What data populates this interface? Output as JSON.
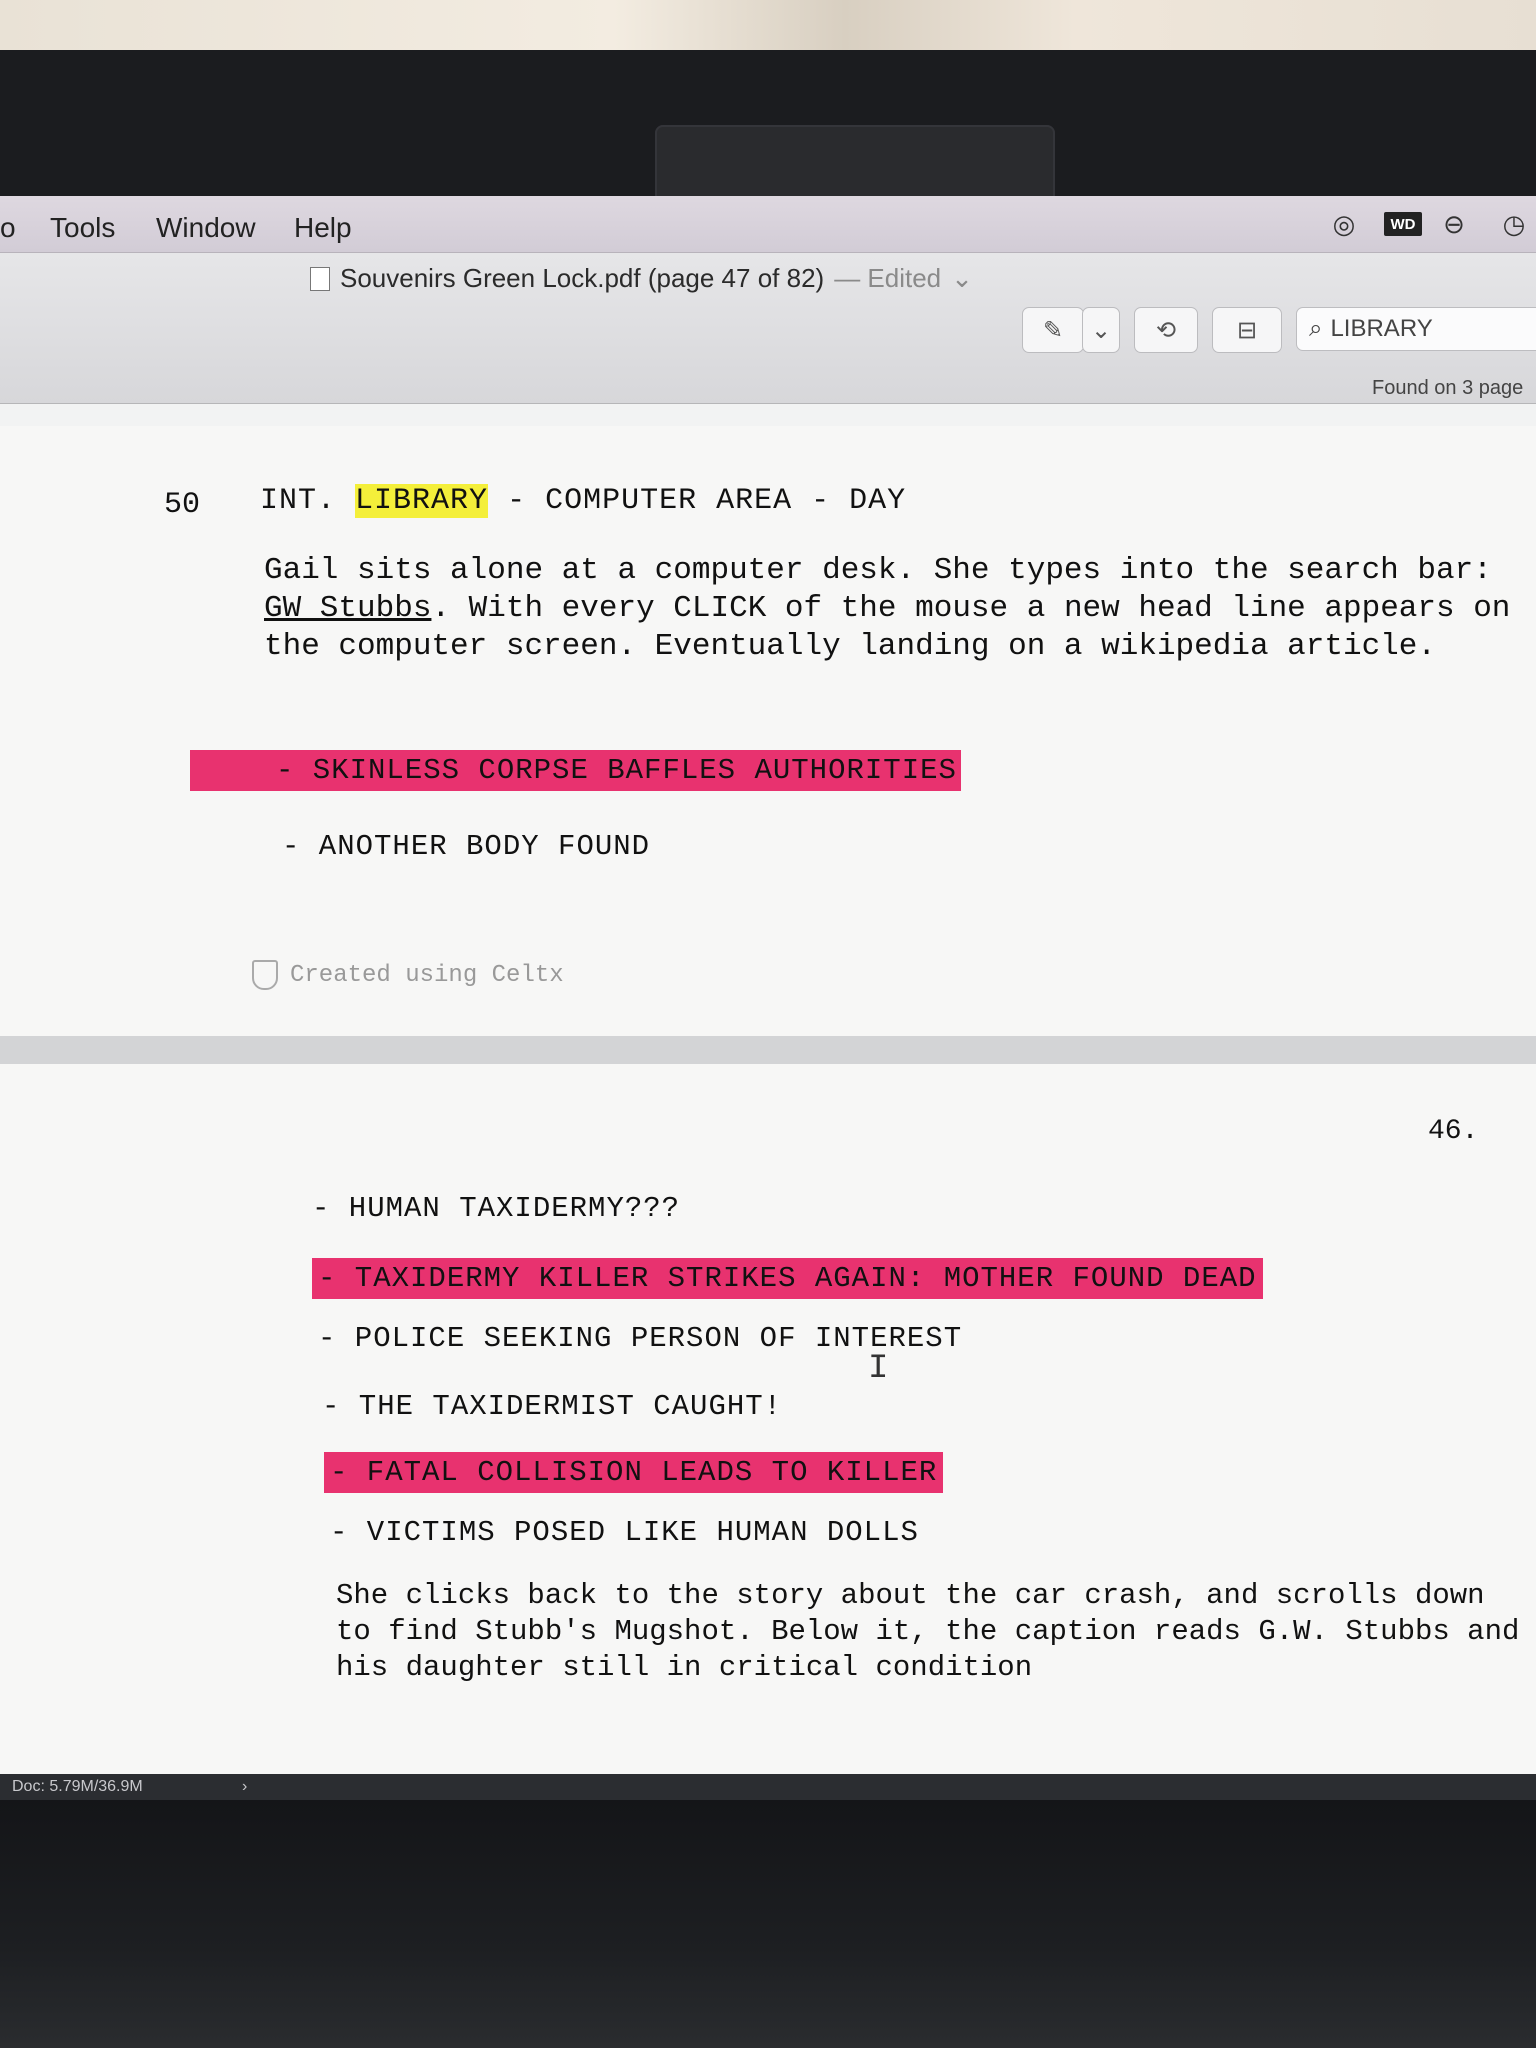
{
  "menubar": {
    "items": [
      "o",
      "Tools",
      "Window",
      "Help"
    ],
    "status_icons": [
      "creative-cloud-icon",
      "wd-icon",
      "sync-icon",
      "time-machine-icon"
    ],
    "wd_label": "WD"
  },
  "window": {
    "title": "Souvenirs Green Lock.pdf (page 47 of 82)",
    "edited": "— Edited"
  },
  "toolbar": {
    "search_value": "LIBRARY",
    "found_text": "Found on 3 page"
  },
  "page1": {
    "scene_number": "50",
    "scene_head": {
      "prefix": "INT.",
      "highlight": "LIBRARY",
      "suffix": "- COMPUTER AREA - DAY"
    },
    "action": {
      "part1": "Gail sits alone at a computer desk. She types into the search bar: ",
      "underlined": "GW Stubbs",
      "part2": ". With every CLICK of the mouse a new head line appears on the computer screen. Eventually landing on a wikipedia article."
    },
    "headlines": [
      "- SKINLESS CORPSE BAFFLES AUTHORITIES",
      "- ANOTHER BODY FOUND"
    ],
    "footer": "Created using Celtx"
  },
  "page2": {
    "page_number": "46.",
    "headlines": [
      "- HUMAN TAXIDERMY???",
      "- TAXIDERMY KILLER STRIKES AGAIN: MOTHER FOUND DEAD",
      "- POLICE SEEKING PERSON OF INTEREST",
      "- THE TAXIDERMIST CAUGHT!",
      "- FATAL COLLISION LEADS TO KILLER",
      "- VICTIMS POSED LIKE HUMAN DOLLS"
    ],
    "paragraph": "She clicks back to the story about the car crash, and scrolls down to find Stubb's Mugshot. Below it, the caption reads G.W. Stubbs and his daughter still in critical condition"
  },
  "statusbar": {
    "doc_info": "Doc: 5.79M/36.9M",
    "chevron": "›"
  },
  "colors": {
    "highlight_yellow": "#f4ef3a",
    "highlight_pink": "#e8326f"
  }
}
